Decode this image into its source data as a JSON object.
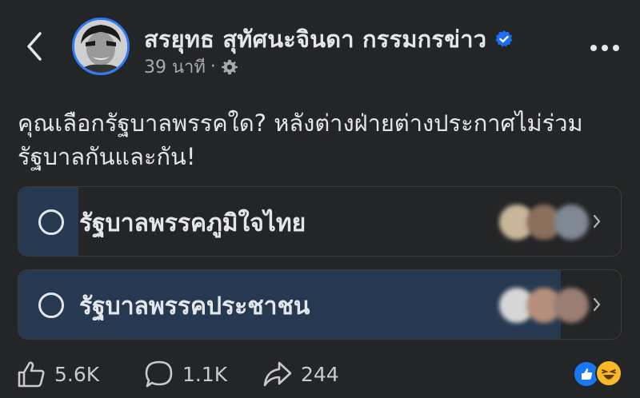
{
  "header": {
    "author_name": "สรยุทธ สุทัศนะจินดา กรรมกรข่าว",
    "time": "39 นาที",
    "separator": "·"
  },
  "post": {
    "text": "คุณเลือกรัฐบาลพรรคใด? หลังต่างฝ่ายต่างประกาศไม่ร่วมรัฐบาลกันและกัน!"
  },
  "poll": {
    "options": [
      {
        "label": "รัฐบาลพรรคภูมิใจไทย",
        "fill_fraction": 0.1
      },
      {
        "label": "รัฐบาลพรรคประชาชน",
        "fill_fraction": 0.9
      }
    ]
  },
  "footer": {
    "likes": "5.6K",
    "comments": "1.1K",
    "shares": "244"
  },
  "colors": {
    "background": "#242526",
    "verified": "#1d6ef5",
    "poll_fill": "#263950",
    "like_reaction": "#1877f2",
    "haha_reaction": "#f7b928"
  },
  "icons": [
    "back-icon",
    "verified-icon",
    "gear-icon",
    "more-icon",
    "radio-icon",
    "chevron-right-icon",
    "like-icon",
    "comment-icon",
    "share-icon",
    "like-reaction-icon",
    "haha-reaction-icon"
  ]
}
